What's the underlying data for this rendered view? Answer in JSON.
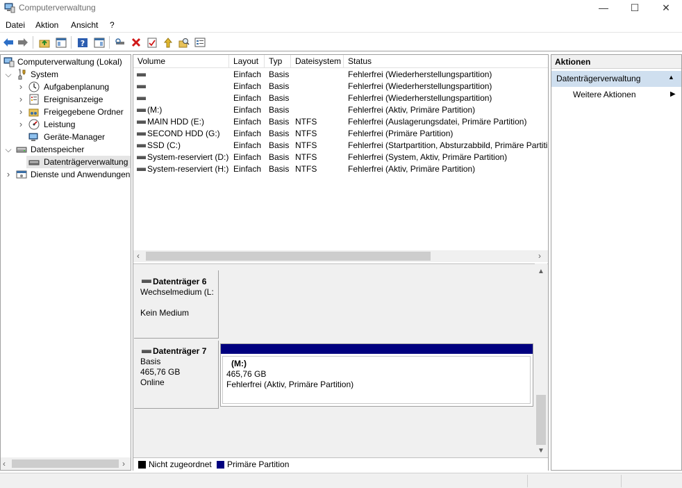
{
  "window": {
    "title": "Computerverwaltung",
    "min_glyph": "—",
    "max_glyph": "☐",
    "close_glyph": "✕"
  },
  "menu": [
    {
      "label": "Datei"
    },
    {
      "label": "Aktion"
    },
    {
      "label": "Ansicht"
    },
    {
      "label": "?"
    }
  ],
  "tree": {
    "items": [
      {
        "label": "Computerverwaltung (Lokal)",
        "icon": "computer-management-icon",
        "level": 0,
        "expander": ""
      },
      {
        "label": "System",
        "icon": "system-tools-icon",
        "level": 1,
        "expander": "expanded"
      },
      {
        "label": "Aufgabenplanung",
        "icon": "task-scheduler-icon",
        "level": 2,
        "expander": "collapsed"
      },
      {
        "label": "Ereignisanzeige",
        "icon": "event-viewer-icon",
        "level": 2,
        "expander": "collapsed"
      },
      {
        "label": "Freigegebene Ordner",
        "icon": "shared-folders-icon",
        "level": 2,
        "expander": "collapsed"
      },
      {
        "label": "Leistung",
        "icon": "performance-icon",
        "level": 2,
        "expander": "collapsed"
      },
      {
        "label": "Geräte-Manager",
        "icon": "device-manager-icon",
        "level": 2,
        "expander": ""
      },
      {
        "label": "Datenspeicher",
        "icon": "storage-icon",
        "level": 1,
        "expander": "expanded"
      },
      {
        "label": "Datenträgerverwaltung",
        "icon": "disk-management-icon",
        "level": 2,
        "expander": "",
        "selected": true
      },
      {
        "label": "Dienste und Anwendungen",
        "icon": "services-apps-icon",
        "level": 1,
        "expander": "collapsed"
      }
    ]
  },
  "volumes": {
    "columns": [
      "Volume",
      "Layout",
      "Typ",
      "Dateisystem",
      "Status"
    ],
    "rows": [
      {
        "volume": "",
        "layout": "Einfach",
        "typ": "Basis",
        "fs": "",
        "status": "Fehlerfrei (Wiederherstellungspartition)"
      },
      {
        "volume": "",
        "layout": "Einfach",
        "typ": "Basis",
        "fs": "",
        "status": "Fehlerfrei (Wiederherstellungspartition)"
      },
      {
        "volume": "",
        "layout": "Einfach",
        "typ": "Basis",
        "fs": "",
        "status": "Fehlerfrei (Wiederherstellungspartition)"
      },
      {
        "volume": " (M:)",
        "layout": "Einfach",
        "typ": "Basis",
        "fs": "",
        "status": "Fehlerfrei (Aktiv, Primäre Partition)"
      },
      {
        "volume": "MAIN HDD (E:)",
        "layout": "Einfach",
        "typ": "Basis",
        "fs": "NTFS",
        "status": "Fehlerfrei (Auslagerungsdatei, Primäre Partition)"
      },
      {
        "volume": "SECOND HDD (G:)",
        "layout": "Einfach",
        "typ": "Basis",
        "fs": "NTFS",
        "status": "Fehlerfrei (Primäre Partition)"
      },
      {
        "volume": "SSD (C:)",
        "layout": "Einfach",
        "typ": "Basis",
        "fs": "NTFS",
        "status": "Fehlerfrei (Startpartition, Absturzabbild, Primäre Partiti"
      },
      {
        "volume": "System-reserviert (D:)",
        "layout": "Einfach",
        "typ": "Basis",
        "fs": "NTFS",
        "status": "Fehlerfrei (System, Aktiv, Primäre Partition)"
      },
      {
        "volume": "System-reserviert (H:)",
        "layout": "Einfach",
        "typ": "Basis",
        "fs": "NTFS",
        "status": "Fehlerfrei (Aktiv, Primäre Partition)"
      }
    ]
  },
  "disks": [
    {
      "name": "Datenträger 6",
      "lines": [
        "Wechselmedium (L:",
        "",
        "Kein Medium"
      ]
    },
    {
      "name": "Datenträger 7",
      "lines": [
        "Basis",
        "465,76 GB",
        "Online"
      ],
      "partition": {
        "label": "(M:)",
        "size": "465,76 GB",
        "status": "Fehlerfrei (Aktiv, Primäre Partition)"
      }
    }
  ],
  "legend": [
    {
      "label": "Nicht zugeordnet",
      "color": "#000000"
    },
    {
      "label": "Primäre Partition",
      "color": "#00007f"
    }
  ],
  "actions": {
    "title": "Aktionen",
    "section": "Datenträgerverwaltung",
    "more": "Weitere Aktionen"
  },
  "colors": {
    "partition_bar": "#00007f",
    "selection": "#e5e5e5",
    "action_header": "#cfdfef"
  }
}
